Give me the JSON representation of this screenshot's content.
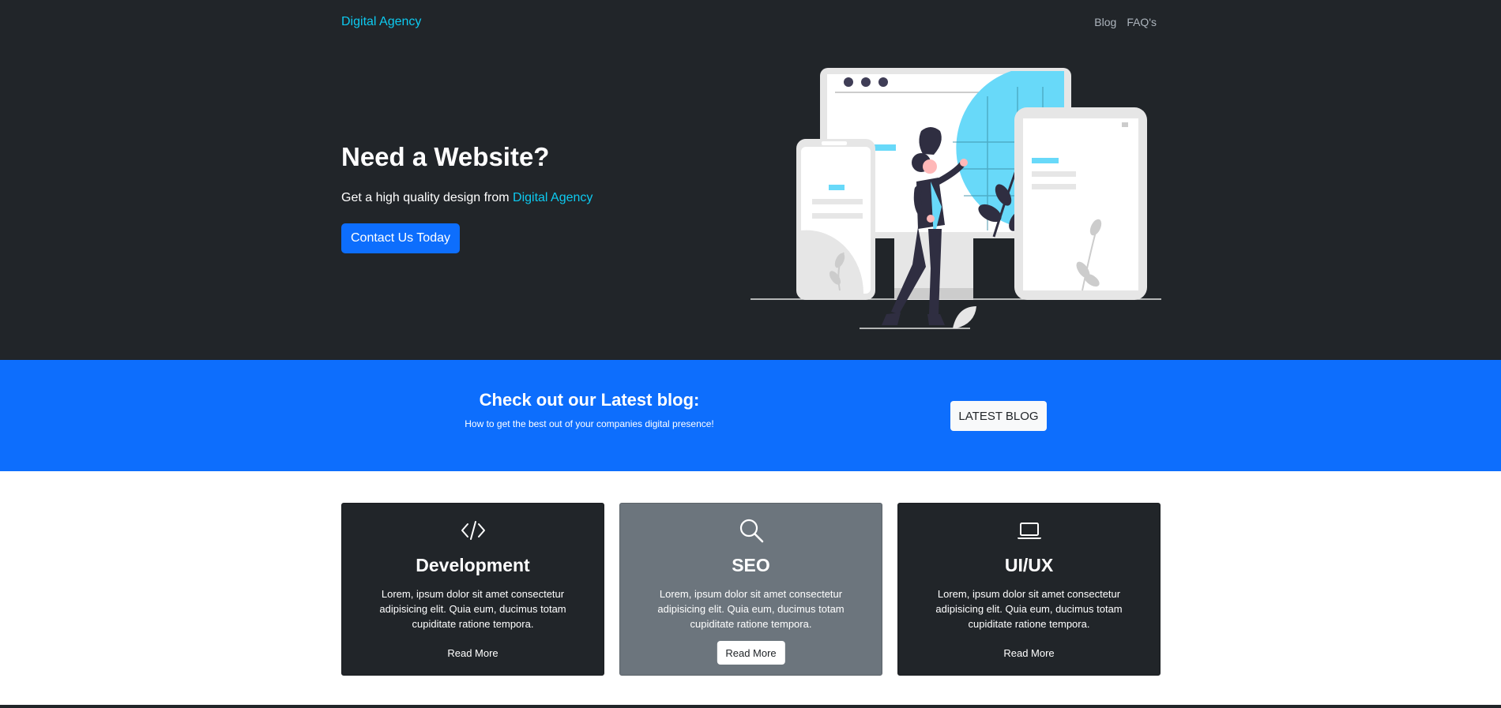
{
  "navbar": {
    "brand": "Digital Agency",
    "links": [
      "Blog",
      "FAQ's"
    ]
  },
  "hero": {
    "title": "Need a Website?",
    "subtitle_prefix": "Get a high quality design from ",
    "subtitle_highlight": "Digital Agency",
    "button": "Contact Us Today",
    "illustration_icon": "person-with-devices-illustration"
  },
  "blog_banner": {
    "title": "Check out our Latest blog:",
    "subtitle": "How to get the best out of your companies digital presence!",
    "button": "LATEST BLOG"
  },
  "cards": [
    {
      "icon": "code-icon",
      "title": "Development",
      "text": "Lorem, ipsum dolor sit amet consectetur adipisicing elit. Quia eum, ducimus totam cupiditate ratione tempora.",
      "button": "Read More"
    },
    {
      "icon": "search-icon",
      "title": "SEO",
      "text": "Lorem, ipsum dolor sit amet consectetur adipisicing elit. Quia eum, ducimus totam cupiditate ratione tempora.",
      "button": "Read More"
    },
    {
      "icon": "laptop-icon",
      "title": "UI/UX",
      "text": "Lorem, ipsum dolor sit amet consectetur adipisicing elit. Quia eum, ducimus totam cupiditate ratione tempora.",
      "button": "Read More"
    }
  ],
  "colors": {
    "dark": "#212529",
    "primary": "#0d6efd",
    "info": "#0dcaf0",
    "secondary": "#6c757d"
  }
}
